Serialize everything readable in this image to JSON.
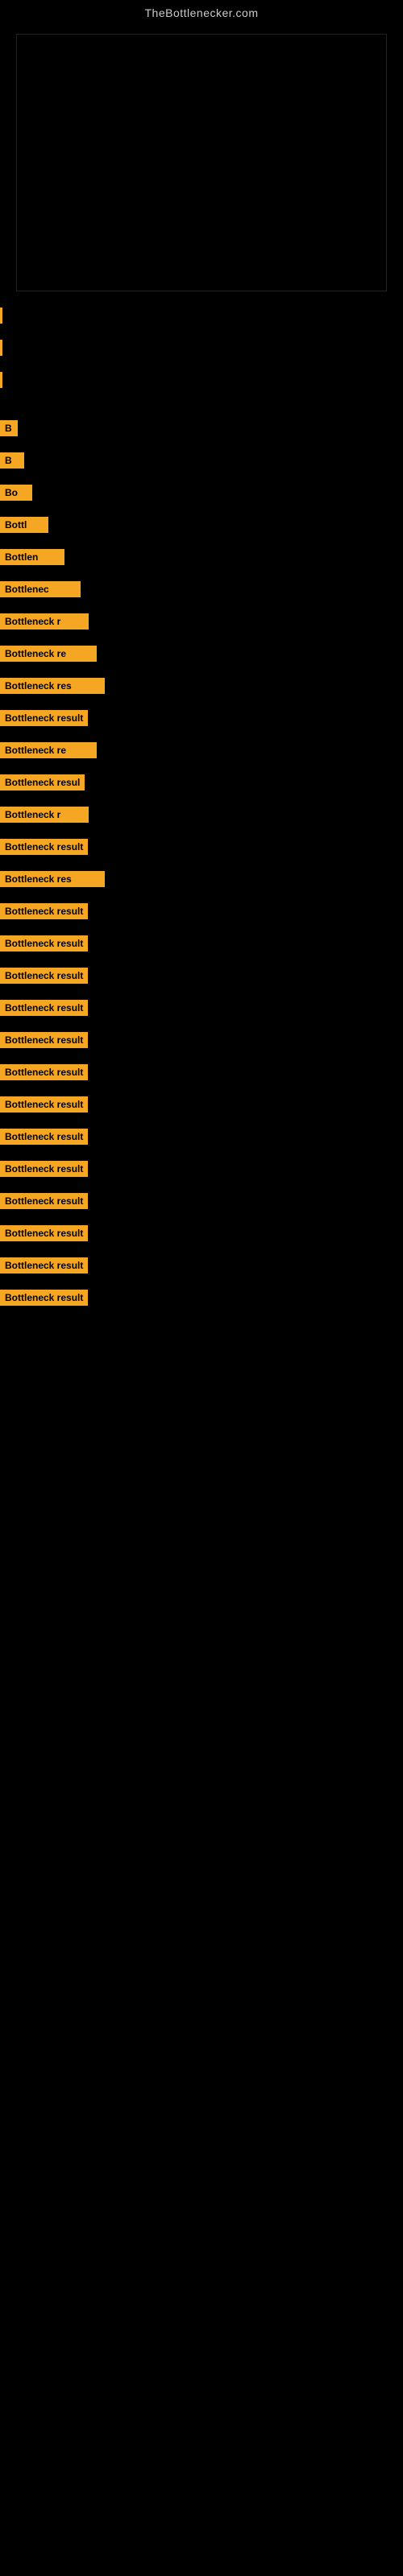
{
  "site": {
    "title": "TheBottlenecker.com"
  },
  "items": [
    {
      "id": 1,
      "label": "B",
      "width_class": "item-w1"
    },
    {
      "id": 2,
      "label": "B",
      "width_class": "item-w2"
    },
    {
      "id": 3,
      "label": "Bo",
      "width_class": "item-w3"
    },
    {
      "id": 4,
      "label": "Bottl",
      "width_class": "item-w4"
    },
    {
      "id": 5,
      "label": "Bottlen",
      "width_class": "item-w5"
    },
    {
      "id": 6,
      "label": "Bottlenec",
      "width_class": "item-w6"
    },
    {
      "id": 7,
      "label": "Bottleneck r",
      "width_class": "item-w7"
    },
    {
      "id": 8,
      "label": "Bottleneck re",
      "width_class": "item-w8"
    },
    {
      "id": 9,
      "label": "Bottleneck res",
      "width_class": "item-w9"
    },
    {
      "id": 10,
      "label": "Bottleneck result",
      "width_class": "item-full"
    },
    {
      "id": 11,
      "label": "Bottleneck re",
      "width_class": "item-w8"
    },
    {
      "id": 12,
      "label": "Bottleneck resul",
      "width_class": "item-full"
    },
    {
      "id": 13,
      "label": "Bottleneck r",
      "width_class": "item-w7"
    },
    {
      "id": 14,
      "label": "Bottleneck result",
      "width_class": "item-full"
    },
    {
      "id": 15,
      "label": "Bottleneck res",
      "width_class": "item-w9"
    },
    {
      "id": 16,
      "label": "Bottleneck result",
      "width_class": "item-full"
    },
    {
      "id": 17,
      "label": "Bottleneck result",
      "width_class": "item-full"
    },
    {
      "id": 18,
      "label": "Bottleneck result",
      "width_class": "item-full"
    },
    {
      "id": 19,
      "label": "Bottleneck result",
      "width_class": "item-full"
    },
    {
      "id": 20,
      "label": "Bottleneck result",
      "width_class": "item-full"
    },
    {
      "id": 21,
      "label": "Bottleneck result",
      "width_class": "item-full"
    },
    {
      "id": 22,
      "label": "Bottleneck result",
      "width_class": "item-full"
    },
    {
      "id": 23,
      "label": "Bottleneck result",
      "width_class": "item-full"
    },
    {
      "id": 24,
      "label": "Bottleneck result",
      "width_class": "item-full"
    },
    {
      "id": 25,
      "label": "Bottleneck result",
      "width_class": "item-full"
    },
    {
      "id": 26,
      "label": "Bottleneck result",
      "width_class": "item-full"
    },
    {
      "id": 27,
      "label": "Bottleneck result",
      "width_class": "item-full"
    },
    {
      "id": 28,
      "label": "Bottleneck result",
      "width_class": "item-full"
    }
  ]
}
